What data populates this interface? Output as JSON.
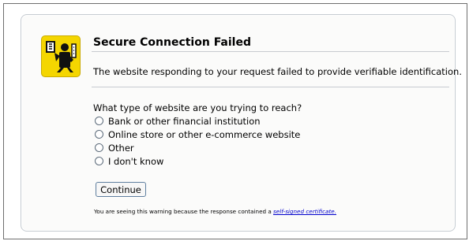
{
  "dialog": {
    "title": "Secure Connection Failed",
    "description": "The website responding to your request failed to provide verifiable identification.",
    "question": "What type of website are you trying to reach?",
    "options": [
      "Bank or other financial institution",
      "Online store or other e-commerce website",
      "Other",
      "I don't know"
    ],
    "continue_label": "Continue",
    "footnote_prefix": "You are seeing this warning because the response contained a ",
    "footnote_link": "self-signed certificate."
  },
  "icons": {
    "warning": "security-officer-icon"
  },
  "colors": {
    "icon_background": "#f4d600",
    "panel_border": "#c5cbd1",
    "link": "#0000cc"
  }
}
